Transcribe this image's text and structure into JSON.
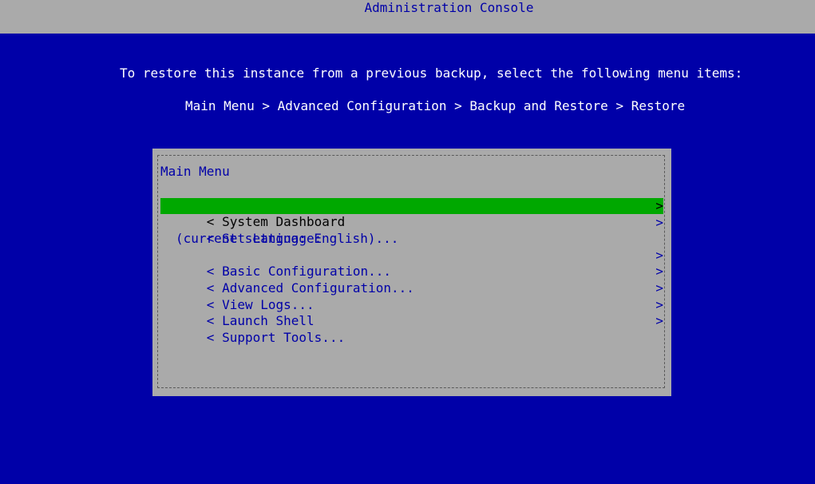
{
  "window": {
    "title": "Administration Console"
  },
  "instructions": {
    "line1": "To restore this instance from a previous backup, select the following menu items:",
    "line2": "Main Menu > Advanced Configuration > Backup and Restore > Restore"
  },
  "dialog": {
    "title": "Main Menu",
    "items": [
      {
        "label": "System Dashboard",
        "selected": true,
        "open_marker": "<",
        "close_marker": ">"
      },
      {
        "label": "Set Language:",
        "sublabel": "(current setting: English)...",
        "open_marker": "<",
        "close_marker": ">"
      },
      {
        "label": "Basic Configuration...",
        "open_marker": "<",
        "close_marker": ">"
      },
      {
        "label": "Advanced Configuration...",
        "open_marker": "<",
        "close_marker": ">"
      },
      {
        "label": "View Logs...",
        "open_marker": "<",
        "close_marker": ">"
      },
      {
        "label": "Launch Shell",
        "open_marker": "<",
        "close_marker": ">"
      },
      {
        "label": "Support Tools...",
        "open_marker": "<",
        "close_marker": ">"
      }
    ]
  },
  "colors": {
    "background": "#0000a8",
    "titlebar": "#aaaaaa",
    "dialog": "#aaaaaa",
    "highlight": "#00a800",
    "text_on_grey": "#0000a8",
    "text_on_blue": "#ffffff"
  }
}
